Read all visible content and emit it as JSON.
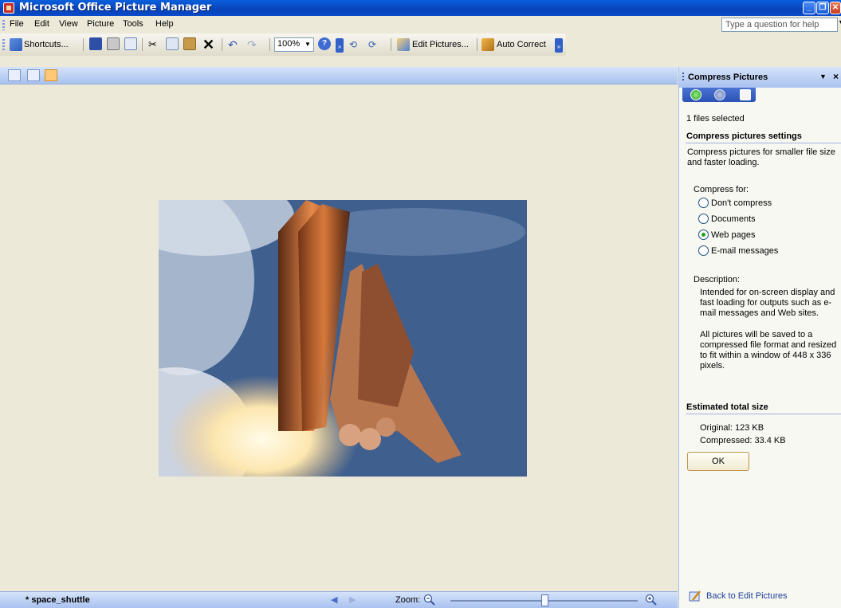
{
  "window": {
    "title": "Microsoft Office Picture Manager"
  },
  "menu": {
    "items": [
      "File",
      "Edit",
      "View",
      "Picture",
      "Tools",
      "Help"
    ],
    "help_placeholder": "Type a question for help"
  },
  "toolbar": {
    "shortcuts": "Shortcuts...",
    "zoom": "100%",
    "edit_pictures": "Edit Pictures...",
    "auto_correct": "Auto Correct"
  },
  "status": {
    "file_name": "* space_shuttle",
    "zoom_label": "Zoom:",
    "zoom_level": 0.5
  },
  "task_pane": {
    "title": "Compress Pictures",
    "files_selected": "1 files selected",
    "settings_heading": "Compress pictures settings",
    "settings_desc": "Compress pictures for smaller file size and faster loading.",
    "compress_for": "Compress for:",
    "options": [
      {
        "label": "Don't compress",
        "checked": false
      },
      {
        "label": "Documents",
        "checked": false
      },
      {
        "label": "Web pages",
        "checked": true
      },
      {
        "label": "E-mail messages",
        "checked": false
      }
    ],
    "description_label": "Description:",
    "description_text": "Intended for on-screen display and fast loading for outputs such as e-mail messages and Web sites.",
    "save_note": "All pictures will be saved to a compressed file format and resized to fit within a window of 448 x 336 pixels.",
    "estimate_heading": "Estimated total size",
    "original": "Original:  123 KB",
    "compressed": "Compressed:  33.4 KB",
    "ok": "OK",
    "back_link": "Back to Edit Pictures"
  }
}
